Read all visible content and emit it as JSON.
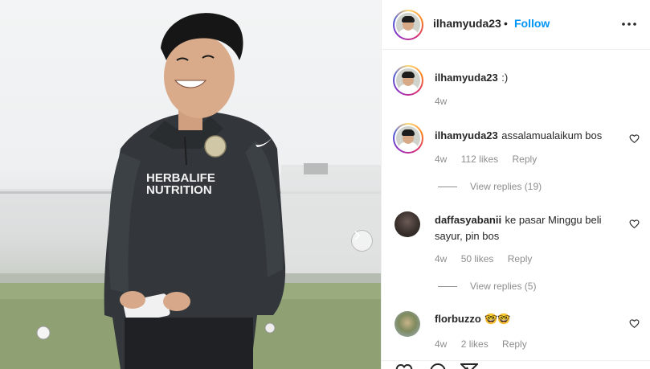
{
  "header": {
    "username": "ilhamyuda23",
    "separator": "•",
    "follow_label": "Follow"
  },
  "caption": {
    "username": "ilhamyuda23",
    "text": ":)",
    "time": "4w"
  },
  "comments": [
    {
      "username": "ilhamyuda23",
      "text": "assalamualaikum bos",
      "time": "4w",
      "likes": "112 likes",
      "reply_label": "Reply",
      "view_replies": "View replies (19)"
    },
    {
      "username": "daffasyabanii",
      "text": "ke pasar Minggu beli sayur, pin bos",
      "time": "4w",
      "likes": "50 likes",
      "reply_label": "Reply",
      "view_replies": "View replies (5)"
    },
    {
      "username": "florbuzzo",
      "text": "🤓🤓",
      "time": "4w",
      "likes": "2 likes",
      "reply_label": "Reply"
    }
  ],
  "photo": {
    "jersey_text_line1": "HERBALIFE",
    "jersey_text_line2": "NUTRITION"
  },
  "icons": {
    "more": "more-options-icon",
    "heart": "heart-icon",
    "next": "chevron-right-icon",
    "like": "like-icon",
    "comment": "comment-icon",
    "share": "share-icon"
  },
  "colors": {
    "follow": "#0095f6",
    "text": "#262626",
    "muted": "#8e8e8e",
    "border": "#efefef"
  }
}
